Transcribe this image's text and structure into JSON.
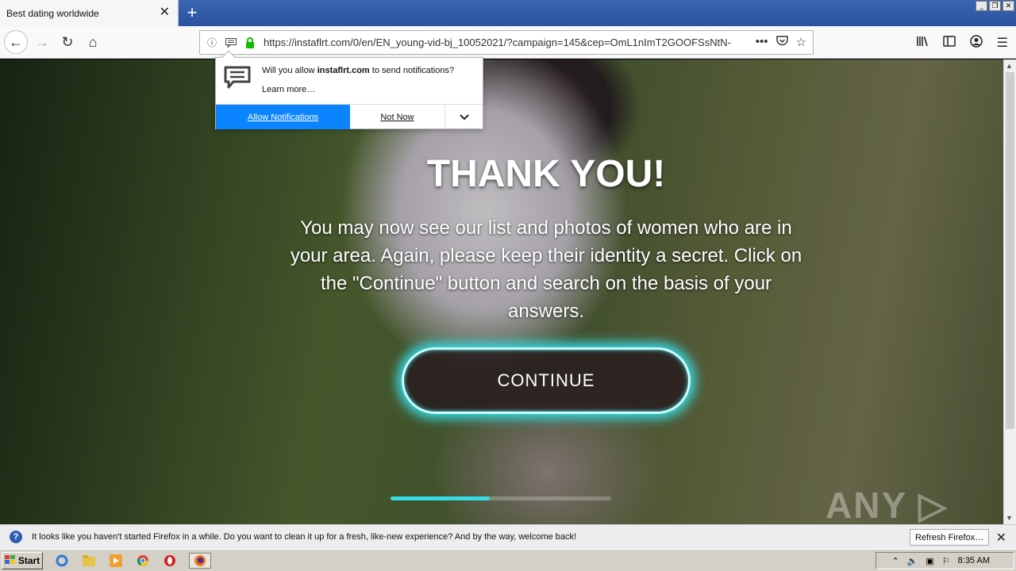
{
  "tab": {
    "title": "Best dating worldwide",
    "close": "✕",
    "new_tab": "+"
  },
  "window_buttons": {
    "minimize": "_",
    "restore": "❐",
    "close": "✕"
  },
  "nav": {
    "back": "←",
    "forward": "→",
    "reload": "↻",
    "home": "⌂"
  },
  "url": {
    "value": "https://instaflrt.com/0/en/EN_young-vid-bj_10052021/?campaign=145&cep=OmL1nImT2GOOFSsNtN-",
    "more": "•••"
  },
  "popup": {
    "question_prefix": "Will you allow ",
    "domain": "instaflrt.com",
    "question_suffix": " to send notifications?",
    "learn_more": "Learn more…",
    "allow": "Allow Notifications",
    "not_now": "Not Now",
    "dropdown": "⌄"
  },
  "page": {
    "title": "THANK YOU!",
    "message": "You may now see our list and photos of women who are in your area. Again, please keep their identity a secret. Click on the \"Continue\" button and search on the basis of your answers.",
    "continue": "CONTINUE",
    "progress": 0.45,
    "watermark": "ANY ▷ RUN"
  },
  "notification_bar": {
    "text": "It looks like you haven't started Firefox in a while. Do you want to clean it up for a fresh, like-new experience? And by the way, welcome back!",
    "refresh": "Refresh Firefox…",
    "close": "✕",
    "info": "?"
  },
  "taskbar": {
    "start": "Start",
    "time": "8:35 AM"
  },
  "colors": {
    "accent": "#0a84ff",
    "glow": "#36d9e0"
  }
}
